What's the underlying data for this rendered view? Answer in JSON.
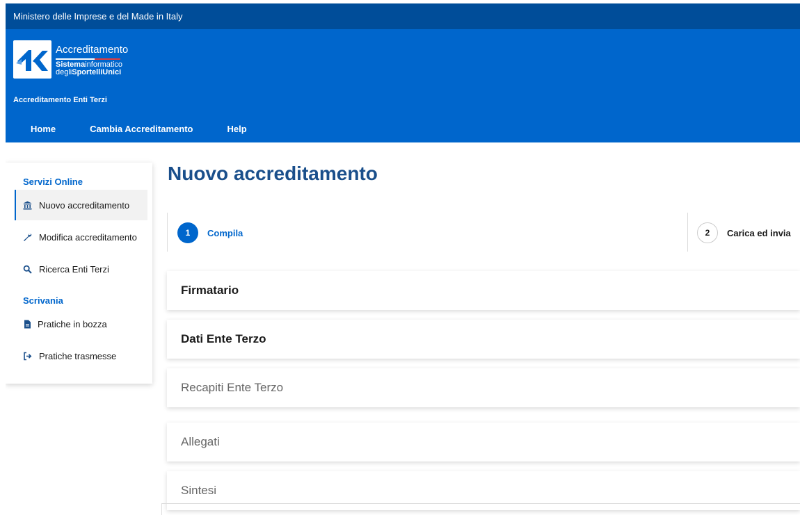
{
  "topbar": {
    "ministry": "Ministero delle Imprese e del Made in Italy"
  },
  "header": {
    "brand_title": "Accreditamento",
    "brand_line1_bold": "Sistema",
    "brand_line1_rest": "informatico",
    "brand_line2_pre": "degli",
    "brand_line2_bold": "SportelliUnici",
    "subtitle": "Accreditamento Enti Terzi",
    "nav": [
      {
        "label": "Home"
      },
      {
        "label": "Cambia Accreditamento"
      },
      {
        "label": "Help"
      }
    ]
  },
  "sidebar": {
    "section1": "Servizi Online",
    "items1": [
      {
        "label": "Nuovo accreditamento",
        "icon": "bank-icon",
        "active": true
      },
      {
        "label": "Modifica accreditamento",
        "icon": "wrench-icon"
      },
      {
        "label": "Ricerca Enti Terzi",
        "icon": "search-icon"
      }
    ],
    "section2": "Scrivania",
    "items2": [
      {
        "label": "Pratiche in bozza",
        "icon": "document-icon"
      },
      {
        "label": "Pratiche trasmesse",
        "icon": "sign-out-icon"
      }
    ]
  },
  "main": {
    "title": "Nuovo accreditamento",
    "steps": [
      {
        "number": "1",
        "label": "Compila",
        "active": true
      },
      {
        "number": "2",
        "label": "Carica ed invia",
        "active": false
      }
    ],
    "sections": [
      {
        "label": "Firmatario",
        "enabled": true
      },
      {
        "label": "Dati Ente Terzo",
        "enabled": true
      },
      {
        "label": "Recapiti Ente Terzo",
        "enabled": false
      },
      {
        "label": "Allegati",
        "enabled": false
      },
      {
        "label": "Sintesi",
        "enabled": false
      }
    ]
  },
  "colors": {
    "topbar": "#004d99",
    "header": "#0066cc",
    "title": "#1a4f8b",
    "accent": "#0066cc"
  }
}
